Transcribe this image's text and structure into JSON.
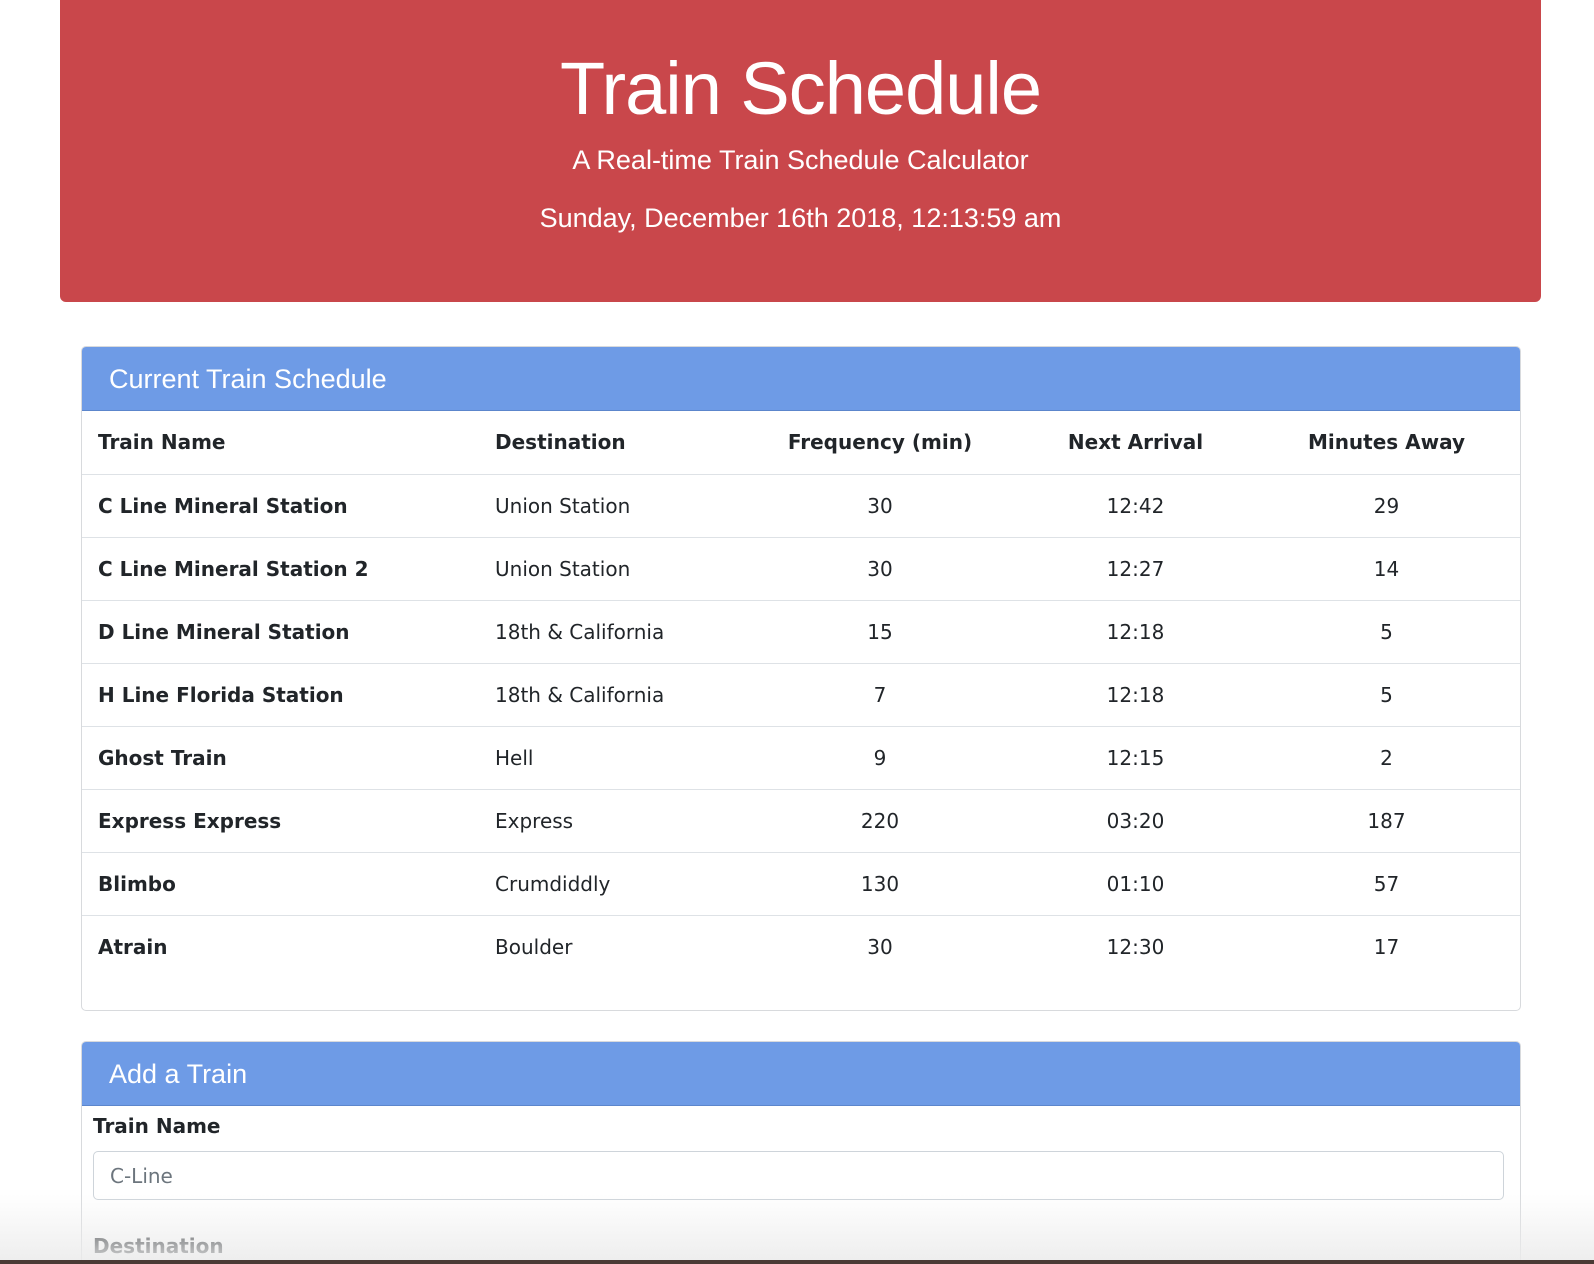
{
  "header": {
    "title": "Train Schedule",
    "subtitle": "A Real-time Train Schedule Calculator",
    "datetime": "Sunday, December 16th 2018, 12:13:59 am"
  },
  "schedule": {
    "heading": "Current Train Schedule",
    "columns": [
      "Train Name",
      "Destination",
      "Frequency (min)",
      "Next Arrival",
      "Minutes Away"
    ],
    "rows": [
      {
        "name": "C Line Mineral Station",
        "destination": "Union Station",
        "frequency": "30",
        "next": "12:42",
        "away": "29"
      },
      {
        "name": "C Line Mineral Station 2",
        "destination": "Union Station",
        "frequency": "30",
        "next": "12:27",
        "away": "14"
      },
      {
        "name": "D Line Mineral Station",
        "destination": "18th & California",
        "frequency": "15",
        "next": "12:18",
        "away": "5"
      },
      {
        "name": "H Line Florida Station",
        "destination": "18th & California",
        "frequency": "7",
        "next": "12:18",
        "away": "5"
      },
      {
        "name": "Ghost Train",
        "destination": "Hell",
        "frequency": "9",
        "next": "12:15",
        "away": "2"
      },
      {
        "name": "Express Express",
        "destination": "Express",
        "frequency": "220",
        "next": "03:20",
        "away": "187"
      },
      {
        "name": "Blimbo",
        "destination": "Crumdiddly",
        "frequency": "130",
        "next": "01:10",
        "away": "57"
      },
      {
        "name": "Atrain",
        "destination": "Boulder",
        "frequency": "30",
        "next": "12:30",
        "away": "17"
      }
    ]
  },
  "add_train": {
    "heading": "Add a Train",
    "train_name_label": "Train Name",
    "train_name_placeholder": "C-Line",
    "destination_label": "Destination"
  },
  "colors": {
    "header_bg": "#c9474b",
    "card_header_bg": "#6e9be6"
  }
}
